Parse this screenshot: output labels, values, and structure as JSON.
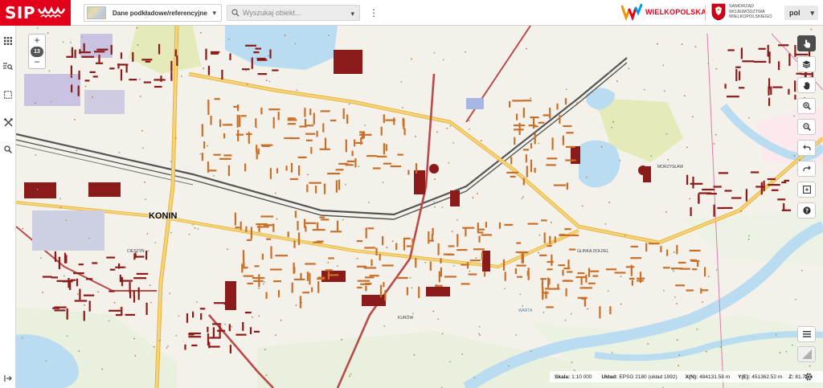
{
  "app": {
    "logo_text": "SIP",
    "basemap_label": "Dane podkładowe/referencyjne",
    "search_placeholder": "Wyszukaj obiekt...",
    "brand_wielkopolska": "WIELKOPOLSKA",
    "samorzad_text": "Samorząd Województwa Wielkopolskiego",
    "language": "pol"
  },
  "zoom": {
    "plus": "+",
    "level": "13",
    "minus": "−"
  },
  "sidebar": {
    "items": [
      {
        "icon": "apps-grid-icon"
      },
      {
        "icon": "search-list-icon"
      },
      {
        "icon": "select-area-icon"
      },
      {
        "icon": "tools-icon"
      },
      {
        "icon": "search-icon"
      },
      {
        "icon": "collapse-arrow-icon"
      }
    ]
  },
  "toolbar_right": [
    {
      "icon": "pointer-icon",
      "active": true
    },
    {
      "icon": "layers-icon"
    },
    {
      "icon": "pan-hand-icon"
    },
    {
      "icon": "zoom-in-icon"
    },
    {
      "icon": "zoom-out-icon"
    },
    {
      "icon": "undo-icon"
    },
    {
      "icon": "redo-icon"
    },
    {
      "icon": "full-extent-icon"
    },
    {
      "icon": "help-icon"
    },
    {
      "icon": "legend-list-icon"
    },
    {
      "icon": "minimap-corner-icon"
    }
  ],
  "map_labels": {
    "city": "KONIN",
    "district_glinka": "GLINKA DOŁDEL",
    "river_warta": "WARTA",
    "district_kurow": "KURÓW",
    "district_marantow": "MORZYSŁAW",
    "district_cieszyn": "CIESZYŃ"
  },
  "status": {
    "scale_label": "Skala:",
    "scale_value": "1:10 000",
    "crs_label": "Układ:",
    "crs_value": "EPSG 2180 (układ 1992)",
    "x_label": "X(N):",
    "x_value": "484131.58 m",
    "y_label": "Y(E):",
    "y_value": "451362.52 m",
    "z_label": "Z:",
    "z_value": "81.71"
  },
  "colors": {
    "brand_red": "#e3001b",
    "building_dark": "#8b1a1a",
    "building_orange": "#c8702a",
    "water": "#b9dcf0",
    "road_main": "#f1c64f",
    "rail": "#555555",
    "park": "#e4eab8"
  }
}
